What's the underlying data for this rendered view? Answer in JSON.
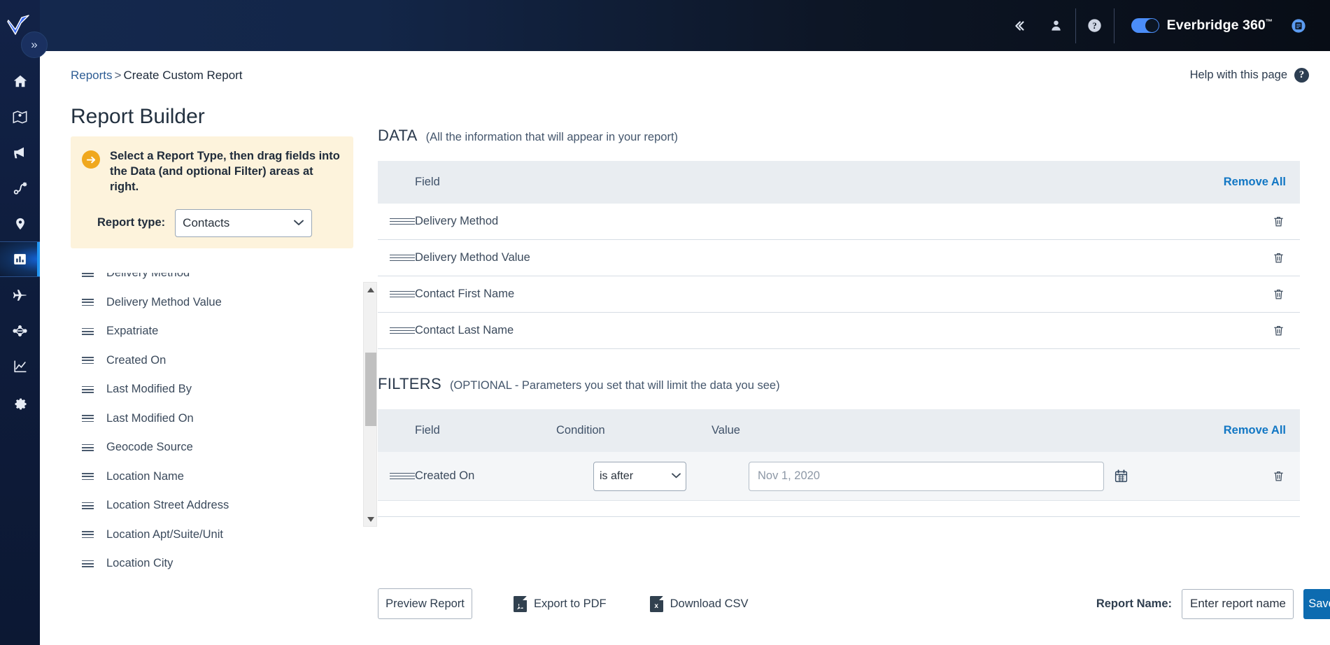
{
  "topbar": {
    "logo_icon": "everbridge-checkmark-logo",
    "collapse_icon": "chevrons-left-icon",
    "user_icon": "user-icon",
    "help_icon": "help-circle-icon",
    "e360_label": "Everbridge 360",
    "e360_tm": "™",
    "notes_icon": "notes-icon",
    "toggle_on": true,
    "accent_blue": "#4b8df8",
    "bg_dark": "#0c1624"
  },
  "rail": {
    "collapse_label": "»",
    "items": [
      {
        "name": "home",
        "icon": "home-icon",
        "active": false
      },
      {
        "name": "situational-awareness",
        "icon": "map-icon",
        "active": false
      },
      {
        "name": "notifications",
        "icon": "megaphone-icon",
        "active": false
      },
      {
        "name": "workflow",
        "icon": "workflow-icon",
        "active": false
      },
      {
        "name": "locations",
        "icon": "map-pin-icon",
        "active": false
      },
      {
        "name": "reports",
        "icon": "bar-chart-icon",
        "active": true
      },
      {
        "name": "travel",
        "icon": "airplane-icon",
        "active": false
      },
      {
        "name": "network",
        "icon": "network-icon",
        "active": false
      },
      {
        "name": "analytics",
        "icon": "line-chart-icon",
        "active": false
      },
      {
        "name": "settings",
        "icon": "gear-icon",
        "active": false
      }
    ]
  },
  "breadcrumb": {
    "parent": "Reports",
    "separator": ">",
    "current": "Create Custom Report"
  },
  "help_with_page": {
    "label": "Help with this page",
    "icon": "question-circle-icon"
  },
  "page_title": "Report Builder",
  "hint": {
    "icon": "arrow-right-circle-icon",
    "text": "Select a Report Type, then drag fields into the Data (and optional Filter) areas at right.",
    "report_type_label": "Report type:",
    "report_type_value": "Contacts",
    "report_type_options": [
      "Contacts"
    ],
    "caret_icon": "chevron-down-icon",
    "bg_color": "#fdf3dc"
  },
  "field_list": {
    "items": [
      "Delivery Method",
      "Delivery Method Value",
      "Expatriate",
      "Created On",
      "Last Modified By",
      "Last Modified On",
      "Geocode Source",
      "Location Name",
      "Location Street Address",
      "Location Apt/Suite/Unit",
      "Location City"
    ],
    "drag_icon": "drag-handle-icon",
    "scroll_up_icon": "triangle-up-icon",
    "scroll_down_icon": "triangle-down-icon"
  },
  "data_section": {
    "title": "DATA",
    "subtitle": "(All the information that will appear in your report)",
    "column_field": "Field",
    "remove_all": "Remove All",
    "rows": [
      {
        "field": "Delivery Method"
      },
      {
        "field": "Delivery Method Value"
      },
      {
        "field": "Contact First Name"
      },
      {
        "field": "Contact Last Name"
      }
    ],
    "drag_icon": "drag-handle-icon",
    "delete_icon": "trash-icon"
  },
  "filters_section": {
    "title": "FILTERS",
    "subtitle": "(OPTIONAL - Parameters you set that will limit the data you see)",
    "column_field": "Field",
    "column_condition": "Condition",
    "column_value": "Value",
    "remove_all": "Remove All",
    "rows": [
      {
        "field": "Created On",
        "condition": "is after",
        "condition_options": [
          "is after"
        ],
        "value": "",
        "value_placeholder": "Nov 1, 2020",
        "calendar_icon": "calendar-icon"
      }
    ],
    "drag_icon": "drag-handle-icon",
    "delete_icon": "trash-icon",
    "caret_icon": "chevron-down-icon"
  },
  "actions": {
    "preview_label": "Preview Report",
    "export_pdf_label": "Export to PDF",
    "export_pdf_badge": "A",
    "download_csv_label": "Download CSV",
    "download_csv_badge": "x",
    "report_name_label": "Report Name:",
    "report_name_value": "",
    "report_name_placeholder": "Enter report name...",
    "save_label": "Save",
    "save_color": "#0d6bb0"
  },
  "colors": {
    "link_blue": "#1277c4",
    "header_gray": "#e9edf1",
    "filter_row_bg": "#f4f6f8"
  }
}
